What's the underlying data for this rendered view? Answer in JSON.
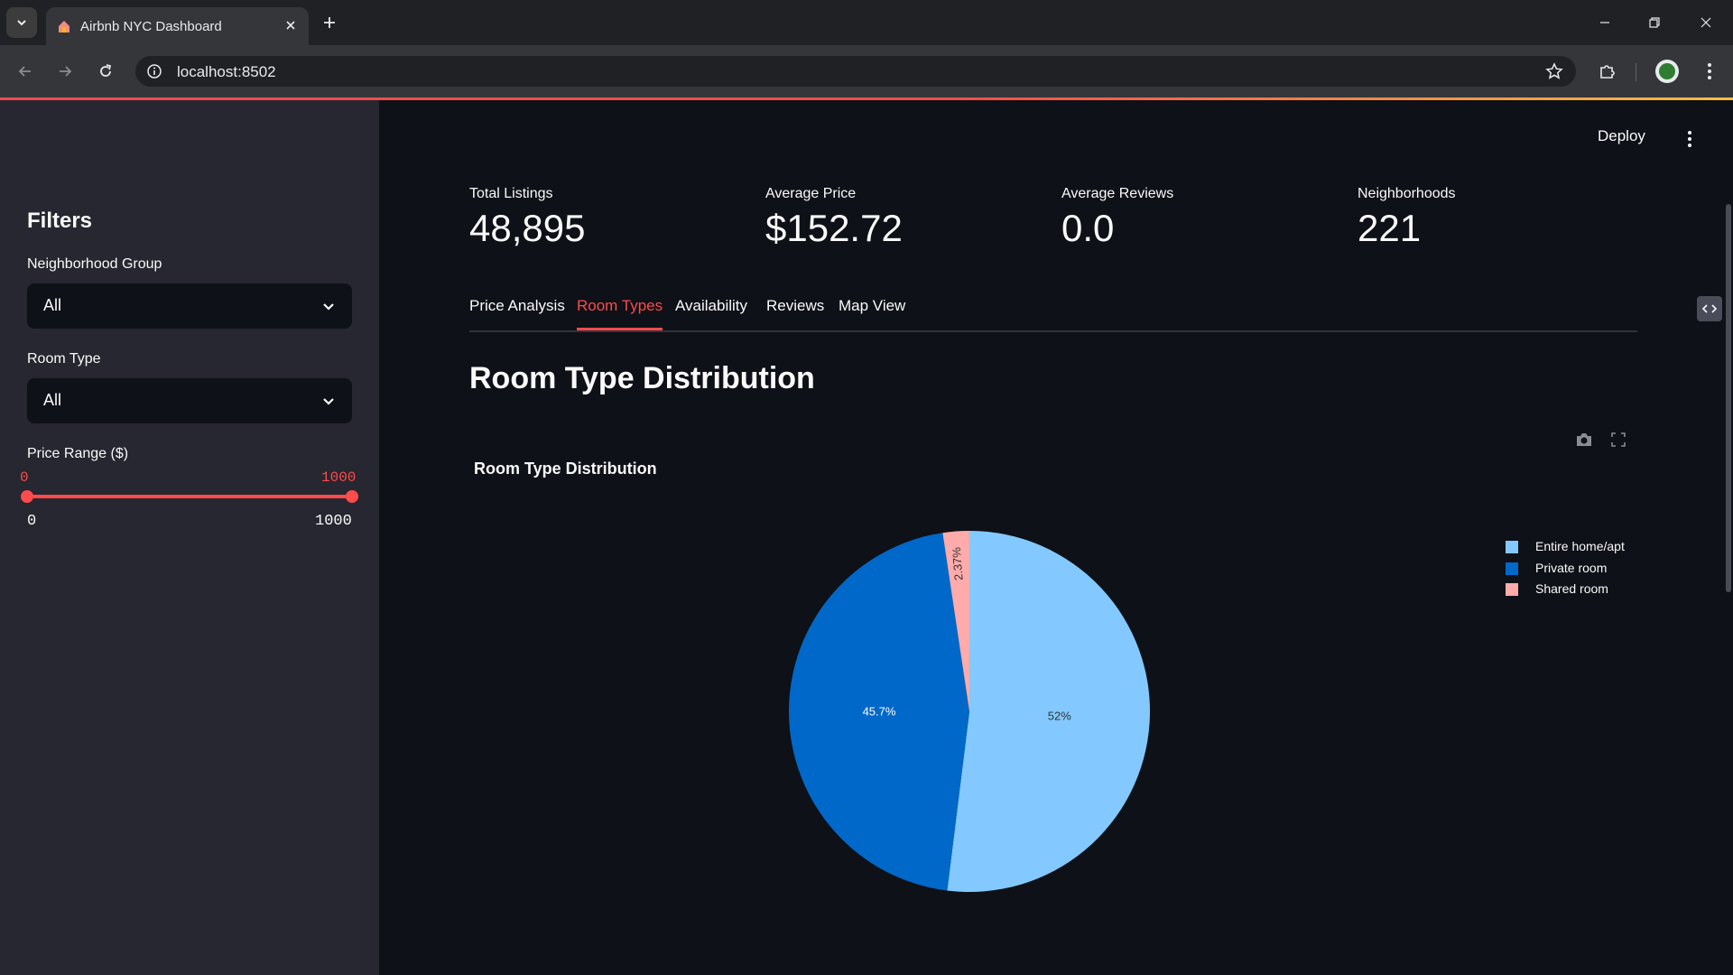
{
  "browser": {
    "tab_title": "Airbnb NYC Dashboard",
    "url": "localhost:8502"
  },
  "app": {
    "deploy_label": "Deploy"
  },
  "sidebar": {
    "title": "Filters",
    "neighborhood_group": {
      "label": "Neighborhood Group",
      "value": "All"
    },
    "room_type": {
      "label": "Room Type",
      "value": "All"
    },
    "price_range": {
      "label": "Price Range ($)",
      "selected_min": "0",
      "selected_max": "1000",
      "min": "0",
      "max": "1000"
    }
  },
  "metrics": [
    {
      "label": "Total Listings",
      "value": "48,895"
    },
    {
      "label": "Average Price",
      "value": "$152.72"
    },
    {
      "label": "Average Reviews",
      "value": "0.0"
    },
    {
      "label": "Neighborhoods",
      "value": "221"
    }
  ],
  "tabs": [
    {
      "label": "Price Analysis",
      "active": false
    },
    {
      "label": "Room Types",
      "active": true
    },
    {
      "label": "Availability",
      "active": false
    },
    {
      "label": "Reviews",
      "active": false
    },
    {
      "label": "Map View",
      "active": false
    }
  ],
  "section_title": "Room Type Distribution",
  "chart_data": {
    "type": "pie",
    "title": "Room Type Distribution",
    "categories": [
      "Entire home/apt",
      "Private room",
      "Shared room"
    ],
    "values": [
      52,
      45.7,
      2.37
    ],
    "data_labels": [
      "52%",
      "45.7%",
      "2.37%"
    ],
    "colors": [
      "#83c9ff",
      "#0068c9",
      "#ffabab"
    ],
    "legend_placement": "top-right"
  },
  "colors": {
    "accent": "#ff4b4b",
    "background": "#0e1117",
    "sidebar": "#262730"
  }
}
